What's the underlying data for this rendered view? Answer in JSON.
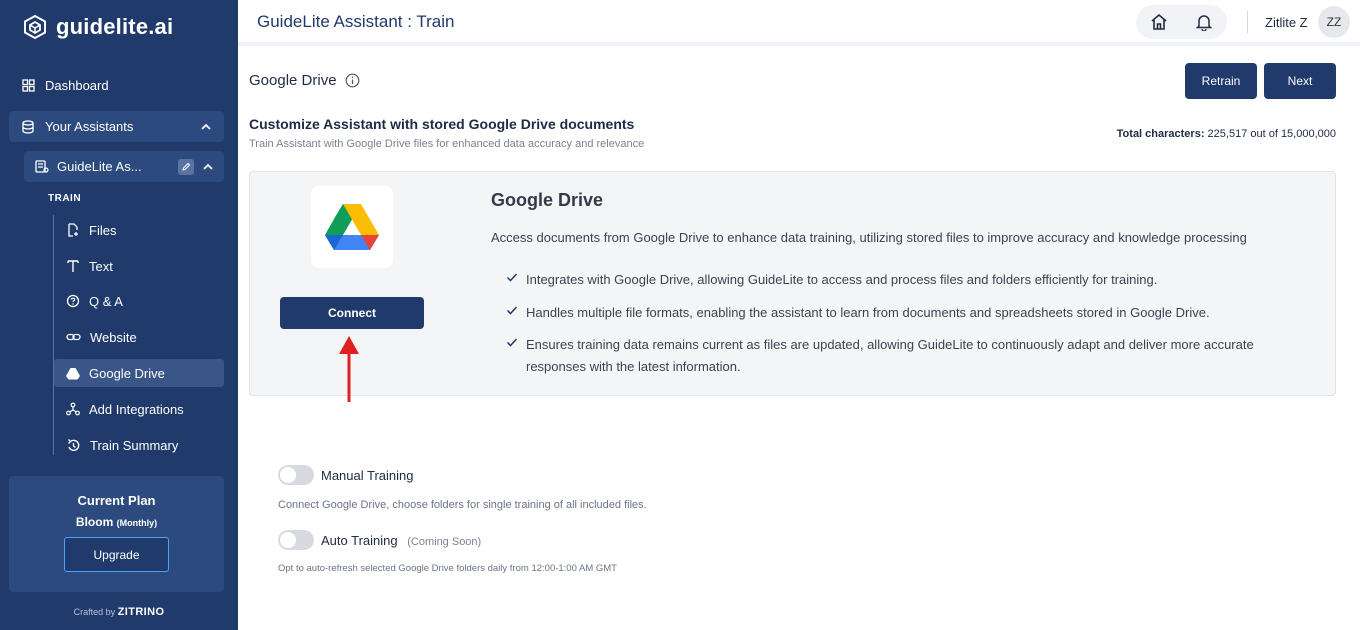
{
  "brand": {
    "name": "guidelite.ai"
  },
  "sidebar": {
    "dashboard": "Dashboard",
    "your_assistants": "Your Assistants",
    "assistant_name": "GuideLite As...",
    "train_header": "TRAIN",
    "items": [
      {
        "label": "Files",
        "icon": "file-plus-icon"
      },
      {
        "label": "Text",
        "icon": "text-icon"
      },
      {
        "label": "Q & A",
        "icon": "question-bubble-icon"
      },
      {
        "label": "Website",
        "icon": "link-icon"
      },
      {
        "label": "Google Drive",
        "icon": "drive-icon",
        "active": true
      },
      {
        "label": "Add Integrations",
        "icon": "integrations-icon"
      },
      {
        "label": "Train Summary",
        "icon": "train-summary-icon"
      }
    ],
    "plan": {
      "title": "Current Plan",
      "name": "Bloom",
      "period": "(Monthly)",
      "upgrade": "Upgrade"
    },
    "crafted_by": "Crafted by",
    "crafted_brand": "ZITRINO"
  },
  "header": {
    "title": "GuideLite Assistant : Train",
    "user_name": "Zitlite Z",
    "avatar_initials": "ZZ"
  },
  "main": {
    "page_title": "Google Drive",
    "retrain": "Retrain",
    "next": "Next",
    "section_title": "Customize Assistant with stored Google Drive documents",
    "section_sub": "Train Assistant with Google Drive files for enhanced data accuracy and relevance",
    "total_label": "Total characters:",
    "total_value": "225,517 out of 15,000,000",
    "card": {
      "title": "Google Drive",
      "description": "Access documents from Google Drive to enhance data training, utilizing stored files to improve accuracy and knowledge processing",
      "connect": "Connect",
      "features": [
        "Integrates with Google Drive, allowing GuideLite to access and process files and folders efficiently for training.",
        "Handles multiple file formats, enabling the assistant to learn from documents and spreadsheets stored in Google Drive.",
        "Ensures training data remains current as files are updated, allowing GuideLite to continuously adapt and deliver more accurate responses with the latest information."
      ]
    },
    "manual_training": {
      "label": "Manual Training",
      "desc": "Connect Google Drive, choose folders for single training of all included files."
    },
    "auto_training": {
      "label": "Auto Training",
      "tag": "(Coming Soon)",
      "desc": "Opt to auto-refresh selected Google Drive folders daily from 12:00-1:00 AM GMT"
    }
  },
  "colors": {
    "sidebar": "#1f3a6b",
    "accent": "#1f3a6b",
    "arrow": "#e0201f"
  }
}
